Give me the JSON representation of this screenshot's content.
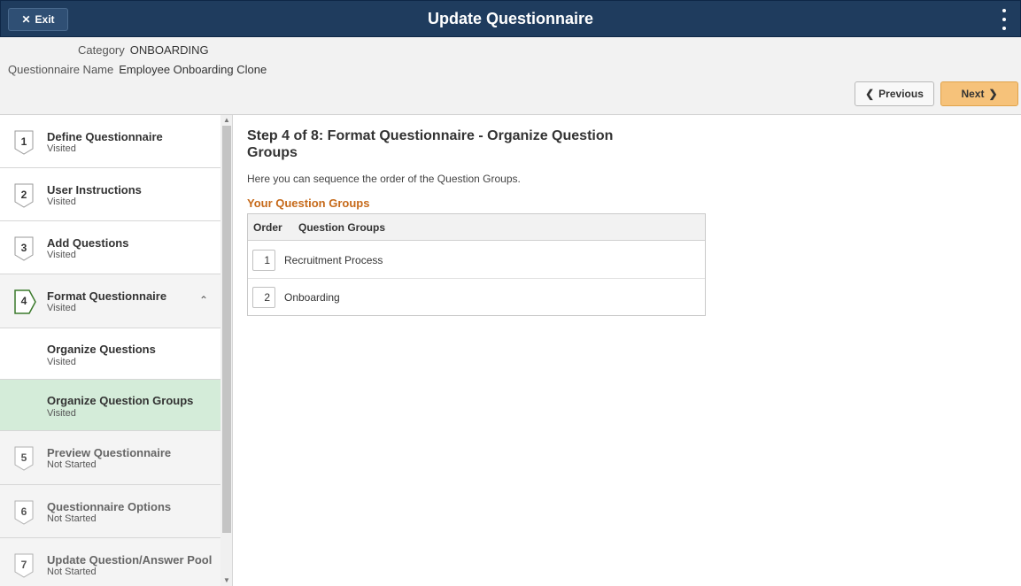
{
  "banner": {
    "exit_label": "Exit",
    "title": "Update Questionnaire"
  },
  "info": {
    "category_label": "Category",
    "category_value": "ONBOARDING",
    "name_label": "Questionnaire Name",
    "name_value": "Employee Onboarding Clone"
  },
  "nav": {
    "previous_label": "Previous",
    "next_label": "Next"
  },
  "steps": [
    {
      "number": "1",
      "title": "Define Questionnaire",
      "status": "Visited"
    },
    {
      "number": "2",
      "title": "User Instructions",
      "status": "Visited"
    },
    {
      "number": "3",
      "title": "Add Questions",
      "status": "Visited"
    },
    {
      "number": "4",
      "title": "Format Questionnaire",
      "status": "Visited"
    },
    {
      "number": "5",
      "title": "Preview Questionnaire",
      "status": "Not Started"
    },
    {
      "number": "6",
      "title": "Questionnaire Options",
      "status": "Not Started"
    },
    {
      "number": "7",
      "title": "Update Question/Answer Pool",
      "status": "Not Started"
    }
  ],
  "substeps": [
    {
      "title": "Organize Questions",
      "status": "Visited"
    },
    {
      "title": "Organize Question Groups",
      "status": "Visited"
    }
  ],
  "main": {
    "title": "Step 4 of 8: Format Questionnaire - Organize Question Groups",
    "description": "Here you can sequence the order of the Question Groups.",
    "groups_heading": "Your Question Groups",
    "col_order": "Order",
    "col_groups": "Question Groups",
    "rows": [
      {
        "order": "1",
        "name": "Recruitment Process"
      },
      {
        "order": "2",
        "name": "Onboarding"
      }
    ]
  },
  "colors": {
    "banner": "#1f3c5e",
    "next_button": "#f6c27a",
    "selected_substep": "#d4ecd9",
    "current_step_badge": "#3b7a2c",
    "group_heading": "#c66a1a"
  }
}
